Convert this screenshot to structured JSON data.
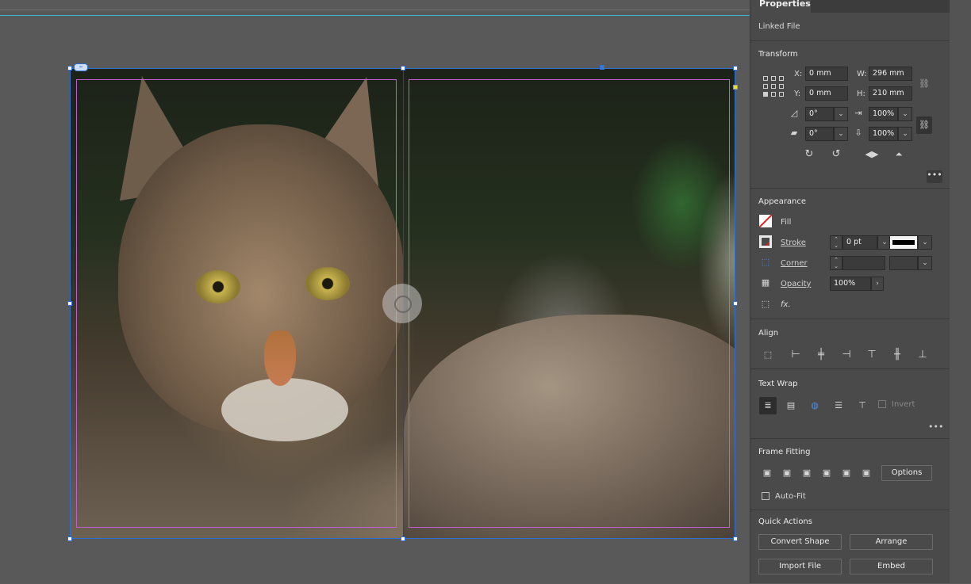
{
  "panel": {
    "tab_title": "Properties",
    "linked_file_label": "Linked File",
    "transform": {
      "title": "Transform",
      "x_label": "X:",
      "x_value": "0 mm",
      "y_label": "Y:",
      "y_value": "0 mm",
      "w_label": "W:",
      "w_value": "296 mm",
      "h_label": "H:",
      "h_value": "210 mm",
      "rotation_value": "0°",
      "shear_value": "0°",
      "scale_x_value": "100%",
      "scale_y_value": "100%"
    },
    "appearance": {
      "title": "Appearance",
      "fill_label": "Fill",
      "stroke_label": "Stroke",
      "stroke_weight": "0 pt",
      "corner_label": "Corner",
      "opacity_label": "Opacity",
      "opacity_value": "100%",
      "fx_label": "fx."
    },
    "align": {
      "title": "Align"
    },
    "text_wrap": {
      "title": "Text Wrap",
      "invert_label": "Invert"
    },
    "frame_fitting": {
      "title": "Frame Fitting",
      "options_label": "Options",
      "auto_fit_label": "Auto-Fit"
    },
    "quick_actions": {
      "title": "Quick Actions",
      "buttons": [
        "Convert Shape",
        "Arrange",
        "Import File",
        "Embed"
      ]
    }
  },
  "colors": {
    "selection": "#2f6fd1",
    "margin_guide": "#c060d0",
    "bleed_guide": "#3fb6c8",
    "panel_bg": "#4a4a4a"
  },
  "icons": {
    "constrain": "chain-icon",
    "rotate_cw": "rotate-cw-icon",
    "rotate_ccw": "rotate-ccw-icon",
    "flip_h": "flip-horizontal-icon",
    "flip_v": "flip-vertical-icon"
  }
}
